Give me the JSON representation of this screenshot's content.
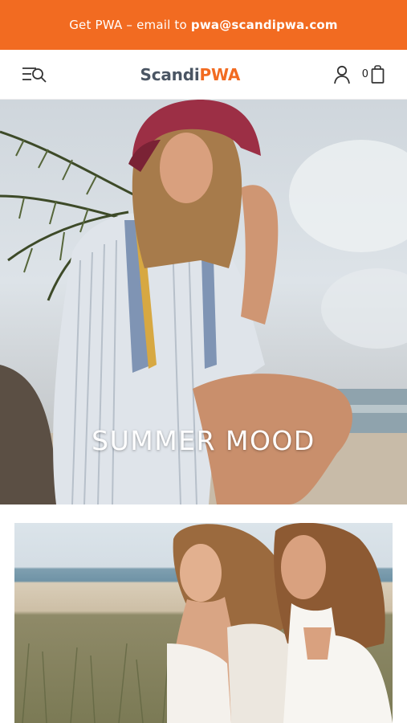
{
  "promo": {
    "text": "Get PWA – email to",
    "email": "pwa@scandipwa.com"
  },
  "header": {
    "logo_main": "Scandi",
    "logo_accent": "PWA",
    "cart_count": "0",
    "icons": [
      "menu-search-icon",
      "account-icon",
      "cart-icon"
    ]
  },
  "hero": {
    "title": "SUMMER MOOD"
  },
  "colors": {
    "accent": "#f26b21",
    "logo_text": "#4a5563"
  }
}
